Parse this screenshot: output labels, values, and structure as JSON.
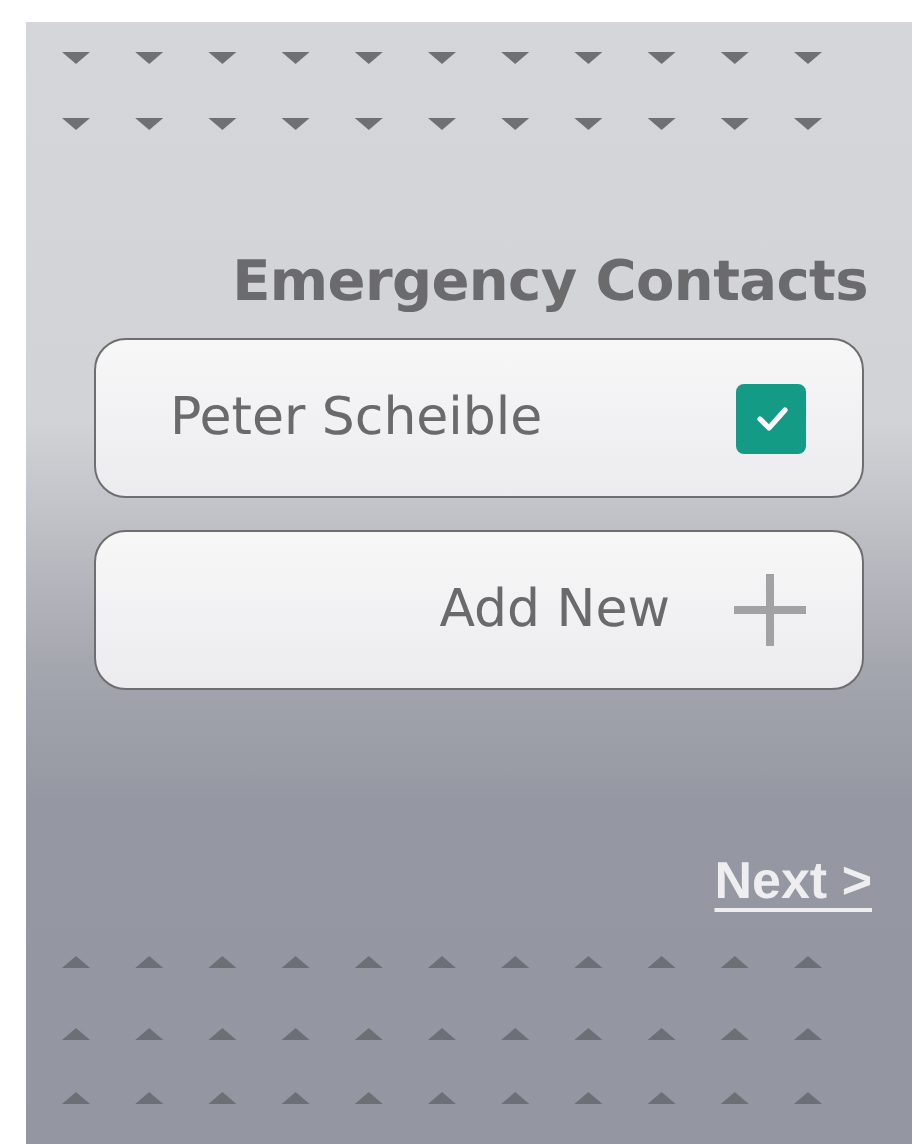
{
  "title": "Emergency Contacts",
  "contacts": [
    {
      "kind": "contact",
      "name": "Peter Scheible",
      "checked": true
    },
    {
      "kind": "add",
      "name": "Add New"
    }
  ],
  "next_link": "Next >"
}
